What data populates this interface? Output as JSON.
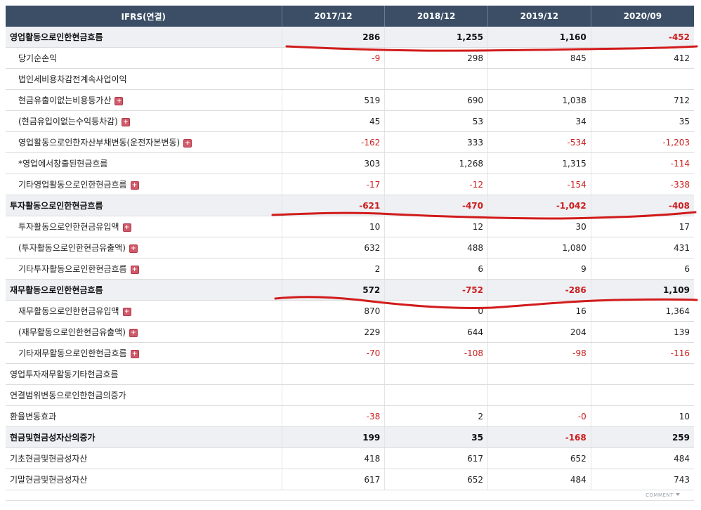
{
  "header": {
    "label_col": "IFRS(연결)",
    "periods": [
      "2017/12",
      "2018/12",
      "2019/12",
      "2020/09"
    ]
  },
  "rows": [
    {
      "label": "영업활동으로인한현금흐름",
      "level": "major",
      "expand": false,
      "values": [
        "286",
        "1,255",
        "1,160",
        "-452"
      ]
    },
    {
      "label": "당기순손익",
      "level": "sub",
      "expand": false,
      "values": [
        "-9",
        "298",
        "845",
        "412"
      ]
    },
    {
      "label": "법인세비용차감전계속사업이익",
      "level": "sub",
      "expand": false,
      "values": [
        "",
        "",
        "",
        ""
      ]
    },
    {
      "label": "현금유출이없는비용등가산",
      "level": "sub",
      "expand": true,
      "values": [
        "519",
        "690",
        "1,038",
        "712"
      ]
    },
    {
      "label": "(현금유입이없는수익등차감)",
      "level": "sub",
      "expand": true,
      "values": [
        "45",
        "53",
        "34",
        "35"
      ]
    },
    {
      "label": "영업활동으로인한자산부채변동(운전자본변동)",
      "level": "sub",
      "expand": true,
      "values": [
        "-162",
        "333",
        "-534",
        "-1,203"
      ]
    },
    {
      "label": "*영업에서창출된현금흐름",
      "level": "sub",
      "expand": false,
      "values": [
        "303",
        "1,268",
        "1,315",
        "-114"
      ]
    },
    {
      "label": "기타영업활동으로인한현금흐름",
      "level": "sub",
      "expand": true,
      "values": [
        "-17",
        "-12",
        "-154",
        "-338"
      ]
    },
    {
      "label": "투자활동으로인한현금흐름",
      "level": "major",
      "expand": false,
      "values": [
        "-621",
        "-470",
        "-1,042",
        "-408"
      ]
    },
    {
      "label": "투자활동으로인한현금유입액",
      "level": "sub",
      "expand": true,
      "values": [
        "10",
        "12",
        "30",
        "17"
      ]
    },
    {
      "label": "(투자활동으로인한현금유출액)",
      "level": "sub",
      "expand": true,
      "values": [
        "632",
        "488",
        "1,080",
        "431"
      ]
    },
    {
      "label": "기타투자활동으로인한현금흐름",
      "level": "sub",
      "expand": true,
      "values": [
        "2",
        "6",
        "9",
        "6"
      ]
    },
    {
      "label": "재무활동으로인한현금흐름",
      "level": "major",
      "expand": false,
      "values": [
        "572",
        "-752",
        "-286",
        "1,109"
      ]
    },
    {
      "label": "재무활동으로인한현금유입액",
      "level": "sub",
      "expand": true,
      "values": [
        "870",
        "0",
        "16",
        "1,364"
      ]
    },
    {
      "label": "(재무활동으로인한현금유출액)",
      "level": "sub",
      "expand": true,
      "values": [
        "229",
        "644",
        "204",
        "139"
      ]
    },
    {
      "label": "기타재무활동으로인한현금흐름",
      "level": "sub",
      "expand": true,
      "values": [
        "-70",
        "-108",
        "-98",
        "-116"
      ]
    },
    {
      "label": "영업투자재무활동기타현금흐름",
      "level": "plain",
      "expand": false,
      "values": [
        "",
        "",
        "",
        ""
      ]
    },
    {
      "label": "연결범위변동으로인한현금의증가",
      "level": "plain",
      "expand": false,
      "values": [
        "",
        "",
        "",
        ""
      ]
    },
    {
      "label": "환율변동효과",
      "level": "plain",
      "expand": false,
      "values": [
        "-38",
        "2",
        "-0",
        "10"
      ]
    },
    {
      "label": "현금및현금성자산의증가",
      "level": "major",
      "expand": false,
      "values": [
        "199",
        "35",
        "-168",
        "259"
      ]
    },
    {
      "label": "기초현금및현금성자산",
      "level": "plain",
      "expand": false,
      "values": [
        "418",
        "617",
        "652",
        "484"
      ]
    },
    {
      "label": "기말현금및현금성자산",
      "level": "plain",
      "expand": false,
      "values": [
        "617",
        "652",
        "484",
        "743"
      ]
    }
  ],
  "expand_glyph": "+",
  "footer": {
    "comment_label": "COMMENT"
  },
  "annotation_color": "#d11b1b"
}
